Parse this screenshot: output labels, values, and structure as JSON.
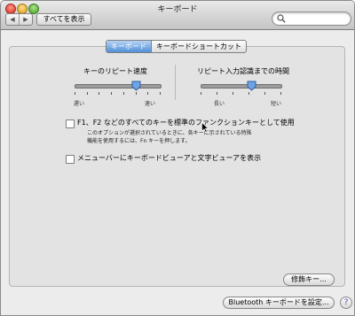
{
  "window": {
    "title": "キーボード"
  },
  "toolbar": {
    "back_glyph": "◀",
    "forward_glyph": "▶",
    "show_all_label": "すべてを表示",
    "search_value": "",
    "icons": {
      "search": "search-icon",
      "back": "back-arrow-icon",
      "forward": "forward-arrow-icon"
    }
  },
  "tabs": [
    {
      "label": "キーボード",
      "selected": true
    },
    {
      "label": "キーボードショートカット",
      "selected": false
    }
  ],
  "key_repeat": {
    "title": "キーのリピート速度",
    "min_label": "遅い",
    "max_label": "速い",
    "value_fraction": 0.72,
    "tick_count": 8
  },
  "repeat_delay": {
    "title": "リピート入力認識までの時間",
    "min_label": "長い",
    "max_label": "短い",
    "value_fraction": 0.64,
    "tick_count": 6
  },
  "options": {
    "fn_keys": {
      "checked": false,
      "label": "F1、F2 などのすべてのキーを標準のファンクションキーとして使用",
      "description_line1": "このオプションが選択されているときに、各キーに示されている特殊",
      "description_line2": "機能を使用するには、Fn キーを押します。"
    },
    "show_viewer": {
      "checked": false,
      "label": "メニューバーにキーボードビューアと文字ビューアを表示"
    }
  },
  "buttons": {
    "modifier_keys": "修飾キー...",
    "bluetooth_setup": "Bluetooth キーボードを設定...",
    "help": "?"
  },
  "colors": {
    "accent": "#4f8fd9",
    "panel": "#e3e3e3"
  }
}
